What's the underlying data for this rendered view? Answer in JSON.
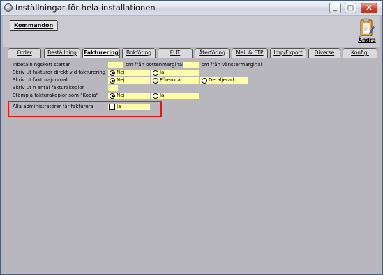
{
  "window": {
    "title": "Inställningar för hela installationen",
    "minimize_label": "_",
    "maximize_label": "□",
    "close_label": "X"
  },
  "toolbar": {
    "kommandon_label": "Kommandon",
    "andra_label": "Ändra"
  },
  "tabs": [
    {
      "label": "Order"
    },
    {
      "label": "Beställning"
    },
    {
      "label": "Fakturering",
      "active": true
    },
    {
      "label": "Bokföring"
    },
    {
      "label": "FUT"
    },
    {
      "label": "Återföring"
    },
    {
      "label": "Mail & FTP"
    },
    {
      "label": "Imp/Export"
    },
    {
      "label": "Diverse"
    },
    {
      "label": "Konfig."
    }
  ],
  "form": {
    "inbetalning_label": "Inbetalningskort startar",
    "botten_label": "cm från bottenmarginal",
    "vanster_label": "cm från vänstermarginal",
    "skriv_direkt_label": "Skriv ut fakturor direkt vid fakturering",
    "skriv_direkt_options": [
      "Nej",
      "Ja"
    ],
    "journal_label": "Skriv ut fakturajournal",
    "journal_options": [
      "Nej",
      "Förenklad",
      "Detaljerad"
    ],
    "antal_kopior_label": "Skriv ut n antal fakturakopior",
    "kopia_label": "Stämpla fakturakopior som \"Kopia\"",
    "kopia_options": [
      "Nej",
      "Ja"
    ],
    "admin_label": "Alla administratörer får fakturera",
    "admin_option": "Ja"
  },
  "colors": {
    "field_yellow": "#fffca6",
    "highlight_red": "#e01818",
    "background_gray": "#b7b7bd"
  }
}
